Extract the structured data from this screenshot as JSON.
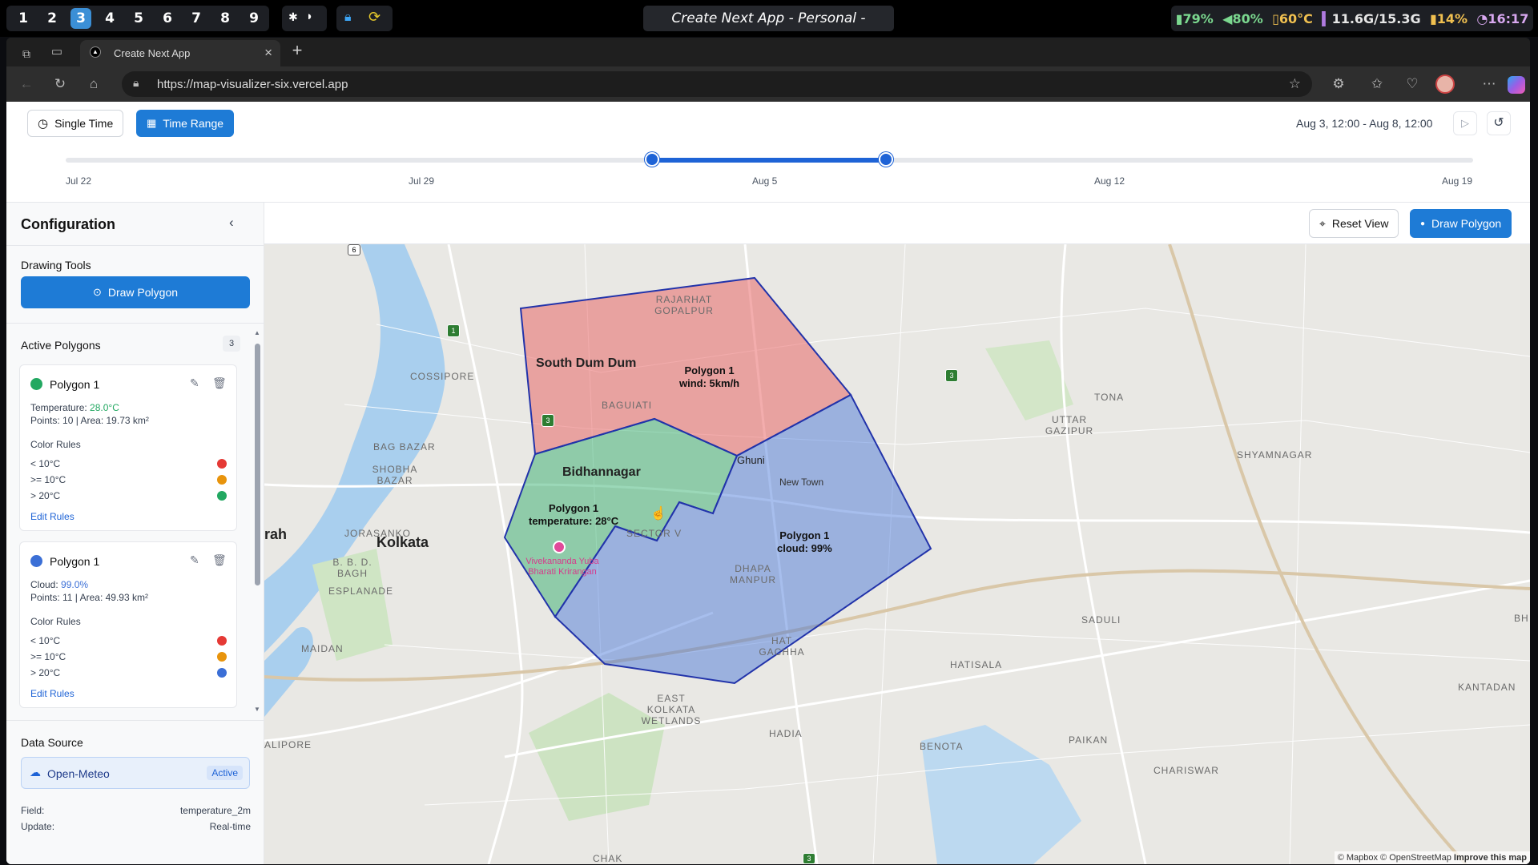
{
  "topbar": {
    "workspaces": [
      "1",
      "2",
      "3",
      "4",
      "5",
      "6",
      "7",
      "8",
      "9"
    ],
    "active_workspace": "3",
    "window_title": "Create Next App - Personal - Microsoft Edge",
    "battery": "79%",
    "volume": "80%",
    "temperature": "60°C",
    "memory": "11.6G/15.3G",
    "cpu": "14%",
    "clock": "16:17"
  },
  "browser": {
    "tab_title": "Create Next App",
    "url": "https://map-visualizer-six.vercel.app"
  },
  "timebar": {
    "single_time_label": "Single Time",
    "time_range_label": "Time Range",
    "range_text": "Aug 3, 12:00 - Aug 8, 12:00",
    "ticks": [
      "Jul 22",
      "Jul 29",
      "Aug 5",
      "Aug 12",
      "Aug 19"
    ]
  },
  "sidebar": {
    "title": "Configuration",
    "drawing_tools_label": "Drawing Tools",
    "draw_polygon_label": "Draw Polygon",
    "active_polygons_label": "Active Polygons",
    "active_polygons_count": "3",
    "polygons": [
      {
        "name": "Polygon 1",
        "color": "#22a861",
        "metric_label": "Temperature:",
        "metric_value": "28.0°C",
        "meta": "Points: 10 | Area: 19.73 km²",
        "rules_label": "Color Rules",
        "rules": [
          {
            "label": "< 10°C",
            "color": "#e53935"
          },
          {
            "label": ">= 10°C",
            "color": "#e8940c"
          },
          {
            "label": "> 20°C",
            "color": "#22a861"
          }
        ],
        "edit_label": "Edit Rules"
      },
      {
        "name": "Polygon 1",
        "color": "#3b6fd6",
        "metric_label": "Cloud:",
        "metric_value": "99.0%",
        "meta": "Points: 11 | Area: 49.93 km²",
        "rules_label": "Color Rules",
        "rules": [
          {
            "label": "< 10°C",
            "color": "#e53935"
          },
          {
            "label": ">= 10°C",
            "color": "#e8940c"
          },
          {
            "label": "> 20°C",
            "color": "#3b6fd6"
          }
        ],
        "edit_label": "Edit Rules"
      }
    ],
    "data_source_label": "Data Source",
    "source_name": "Open-Meteo",
    "source_status": "Active",
    "field_label": "Field:",
    "field_value": "temperature_2m",
    "update_label": "Update:",
    "update_value": "Real-time"
  },
  "map": {
    "reset_view_label": "Reset View",
    "draw_polygon_label": "Draw Polygon",
    "attribution": "© Mapbox © OpenStreetMap",
    "improve": "Improve this map",
    "places": {
      "rajarhat": "RAJARHAT GOPALPUR",
      "south_dum_dum": "South Dum Dum",
      "baguiati": "BAGUIATI",
      "cossipore": "COSSIPORE",
      "bag_bazar": "BAG BAZAR",
      "shobha_bazar": "SHOBHA BAZAR",
      "jorasanko": "JORASANKO",
      "bidhannagar": "Bidhannagar",
      "ghuni": "Ghuni",
      "new_town": "New Town",
      "kolkata": "Kolkata",
      "bbd_bagh": "B. B. D. BAGH",
      "esplanade": "ESPLANADE",
      "maidan": "MAIDAN",
      "alipore": "ALIPORE",
      "sector_v": "SECTOR V",
      "dhapa": "DHAPA MANPUR",
      "hat_gachha": "HAT GACHHA",
      "east_kolkata": "EAST KOLKATA WETLANDS",
      "hadia": "HADIA",
      "chak": "CHAK",
      "tona": "TONA",
      "uttar_gazipur": "UTTAR GAZIPUR",
      "shyamnagar": "SHYAMNAGAR",
      "saduli": "SADULI",
      "hatisala": "HATISALA",
      "benota": "BENOTA",
      "paikan": "PAIKAN",
      "chariswar": "CHARISWAR",
      "kantadan": "KANTADAN",
      "bh": "BH",
      "rah": "rah",
      "vivekananda": "Vivekananda Yuba Bharati Krirangan"
    },
    "polygon_labels": {
      "red": [
        "Polygon 1",
        "wind: 5km/h"
      ],
      "green": [
        "Polygon 1",
        "temperature: 28°C"
      ],
      "blue": [
        "Polygon 1",
        "cloud: 99%"
      ]
    },
    "road_shields": [
      "6",
      "1",
      "3",
      "3",
      "3"
    ]
  }
}
